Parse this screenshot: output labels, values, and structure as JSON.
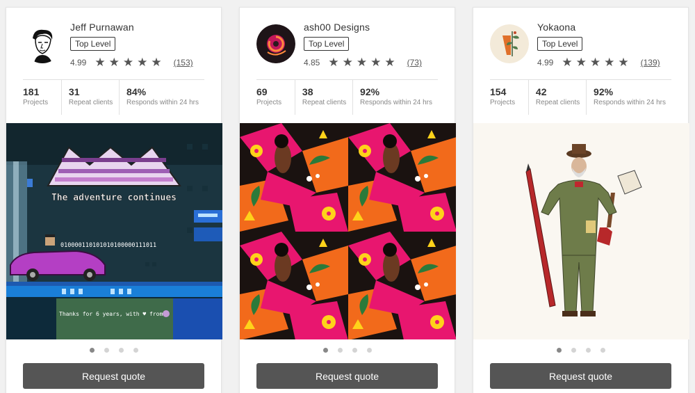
{
  "cards": [
    {
      "name": "Jeff Purnawan",
      "badge": "Top Level",
      "rating": "4.99",
      "stars": "★★★★★",
      "review_count": "(153)",
      "stats": [
        {
          "value": "181",
          "label": "Projects"
        },
        {
          "value": "31",
          "label": "Repeat clients"
        },
        {
          "value": "84%",
          "label": "Responds within 24 hrs"
        }
      ],
      "image": {
        "title_line": "The adventure continues",
        "binary": "010000110101010100000111011",
        "thanks": "Thanks for 6 years, with ♥ from"
      },
      "button": "Request quote",
      "active_slide": 1,
      "slides": 4
    },
    {
      "name": "ash00 Designs",
      "badge": "Top Level",
      "rating": "4.85",
      "stars": "★★★★★",
      "review_count": "(73)",
      "stats": [
        {
          "value": "69",
          "label": "Projects"
        },
        {
          "value": "38",
          "label": "Repeat clients"
        },
        {
          "value": "92%",
          "label": "Responds within 24 hrs"
        }
      ],
      "button": "Request quote",
      "active_slide": 1,
      "slides": 4
    },
    {
      "name": "Yokaona",
      "badge": "Top Level",
      "rating": "4.99",
      "stars": "★★★★★",
      "review_count": "(139)",
      "stats": [
        {
          "value": "154",
          "label": "Projects"
        },
        {
          "value": "42",
          "label": "Repeat clients"
        },
        {
          "value": "92%",
          "label": "Responds within 24 hrs"
        }
      ],
      "button": "Request quote",
      "active_slide": 1,
      "slides": 4
    }
  ],
  "colors": {
    "button_bg": "#555555",
    "card_bg": "#ffffff",
    "page_bg": "#f1f1f1",
    "pattern_pink": "#e8166f",
    "pattern_orange": "#f26a1b",
    "pixel_sky": "#1d3b44"
  },
  "icons": [
    "star-icon",
    "avatar-portrait-icon",
    "avatar-logo-icon",
    "avatar-plant-icon"
  ]
}
